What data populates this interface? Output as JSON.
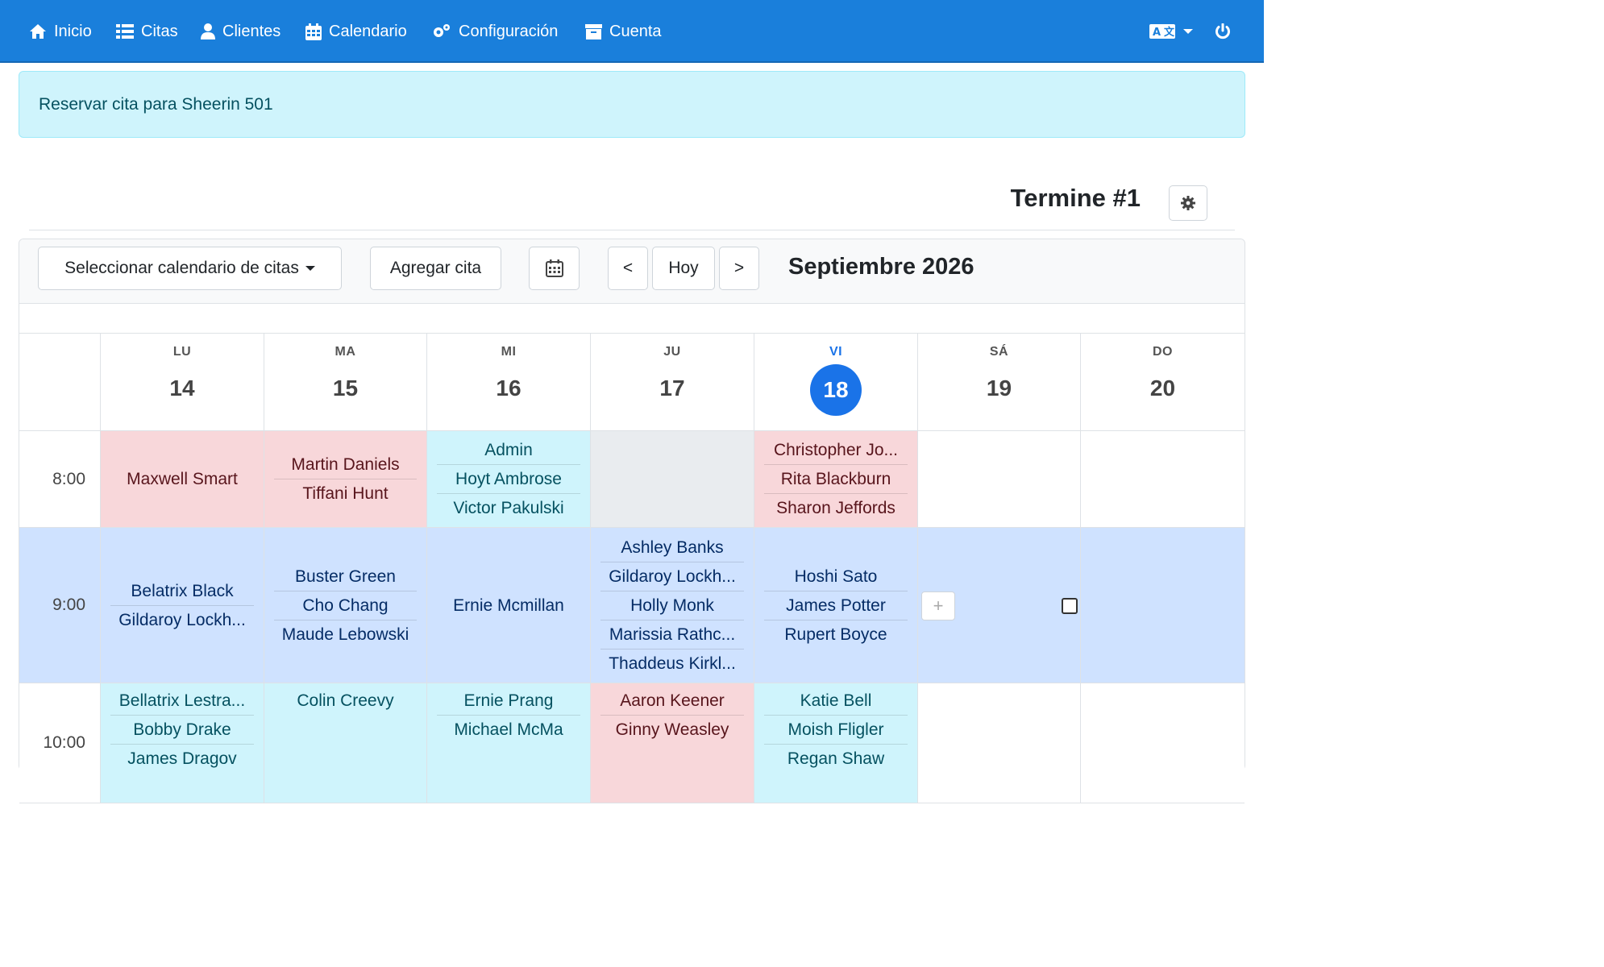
{
  "nav": {
    "items": [
      {
        "label": "Inicio",
        "icon": "home-icon"
      },
      {
        "label": "Citas",
        "icon": "list-icon"
      },
      {
        "label": "Clientes",
        "icon": "user-icon"
      },
      {
        "label": "Calendario",
        "icon": "calendar-icon"
      },
      {
        "label": "Configuración",
        "icon": "cogs-icon"
      },
      {
        "label": "Cuenta",
        "icon": "archive-icon"
      }
    ],
    "right": {
      "language_icon": "language-icon",
      "power_icon": "power-icon"
    },
    "brand_color": "#1a7fdb"
  },
  "alert": {
    "text": "Reservar cita para Sheerin 501"
  },
  "page": {
    "title": "Termine #1"
  },
  "toolbar": {
    "select_calendar": "Seleccionar calendario de citas",
    "add_appointment": "Agregar cita",
    "prev": "<",
    "today": "Hoy",
    "next": ">",
    "month": "Septiembre 2026"
  },
  "days": [
    {
      "dow": "LU",
      "num": "14"
    },
    {
      "dow": "MA",
      "num": "15"
    },
    {
      "dow": "MI",
      "num": "16"
    },
    {
      "dow": "JU",
      "num": "17"
    },
    {
      "dow": "VI",
      "num": "18",
      "today": true
    },
    {
      "dow": "SÁ",
      "num": "19"
    },
    {
      "dow": "DO",
      "num": "20"
    }
  ],
  "rows": [
    {
      "time": "8:00",
      "cells": [
        {
          "color": "red",
          "names": [
            "Maxwell Smart"
          ]
        },
        {
          "color": "red",
          "names": [
            "Martin Daniels",
            "Tiffani Hunt"
          ]
        },
        {
          "color": "cyan",
          "names": [
            "Admin",
            "Hoyt Ambrose",
            "Victor Pakulski"
          ]
        },
        {
          "color": "gray",
          "names": []
        },
        {
          "color": "red",
          "names": [
            "Christopher Jo...",
            "Rita Blackburn",
            "Sharon Jeffords"
          ]
        },
        {
          "color": "white",
          "names": []
        },
        {
          "color": "white",
          "names": []
        }
      ]
    },
    {
      "time": "9:00",
      "cells": [
        {
          "color": "blue",
          "names": [
            "Belatrix Black",
            "Gildaroy Lockh..."
          ]
        },
        {
          "color": "blue",
          "names": [
            "Buster Green",
            "Cho Chang",
            "Maude Lebowski"
          ]
        },
        {
          "color": "blue",
          "names": [
            "Ernie Mcmillan"
          ]
        },
        {
          "color": "blue",
          "names": [
            "Ashley Banks",
            "Gildaroy Lockh...",
            "Holly Monk",
            "Marissia Rathc...",
            "Thaddeus Kirkl..."
          ]
        },
        {
          "color": "blue",
          "names": [
            "Hoshi Sato",
            "James Potter",
            "Rupert Boyce"
          ]
        },
        {
          "color": "blue",
          "names": [],
          "add_button": "+"
        },
        {
          "color": "blue",
          "names": []
        }
      ]
    },
    {
      "time": "10:00",
      "cells": [
        {
          "color": "cyan",
          "names": [
            "Bellatrix Lestra...",
            "Bobby Drake",
            "James Dragov"
          ]
        },
        {
          "color": "cyan",
          "names": [
            "Colin Creevy"
          ]
        },
        {
          "color": "cyan",
          "names": [
            "Ernie Prang",
            "Michael McMa"
          ]
        },
        {
          "color": "red",
          "names": [
            "Aaron Keener",
            "Ginny Weasley"
          ]
        },
        {
          "color": "cyan",
          "names": [
            "Katie Bell",
            "Moish Fligler",
            "Regan Shaw"
          ]
        },
        {
          "color": "white",
          "names": []
        },
        {
          "color": "white",
          "names": []
        }
      ]
    }
  ]
}
